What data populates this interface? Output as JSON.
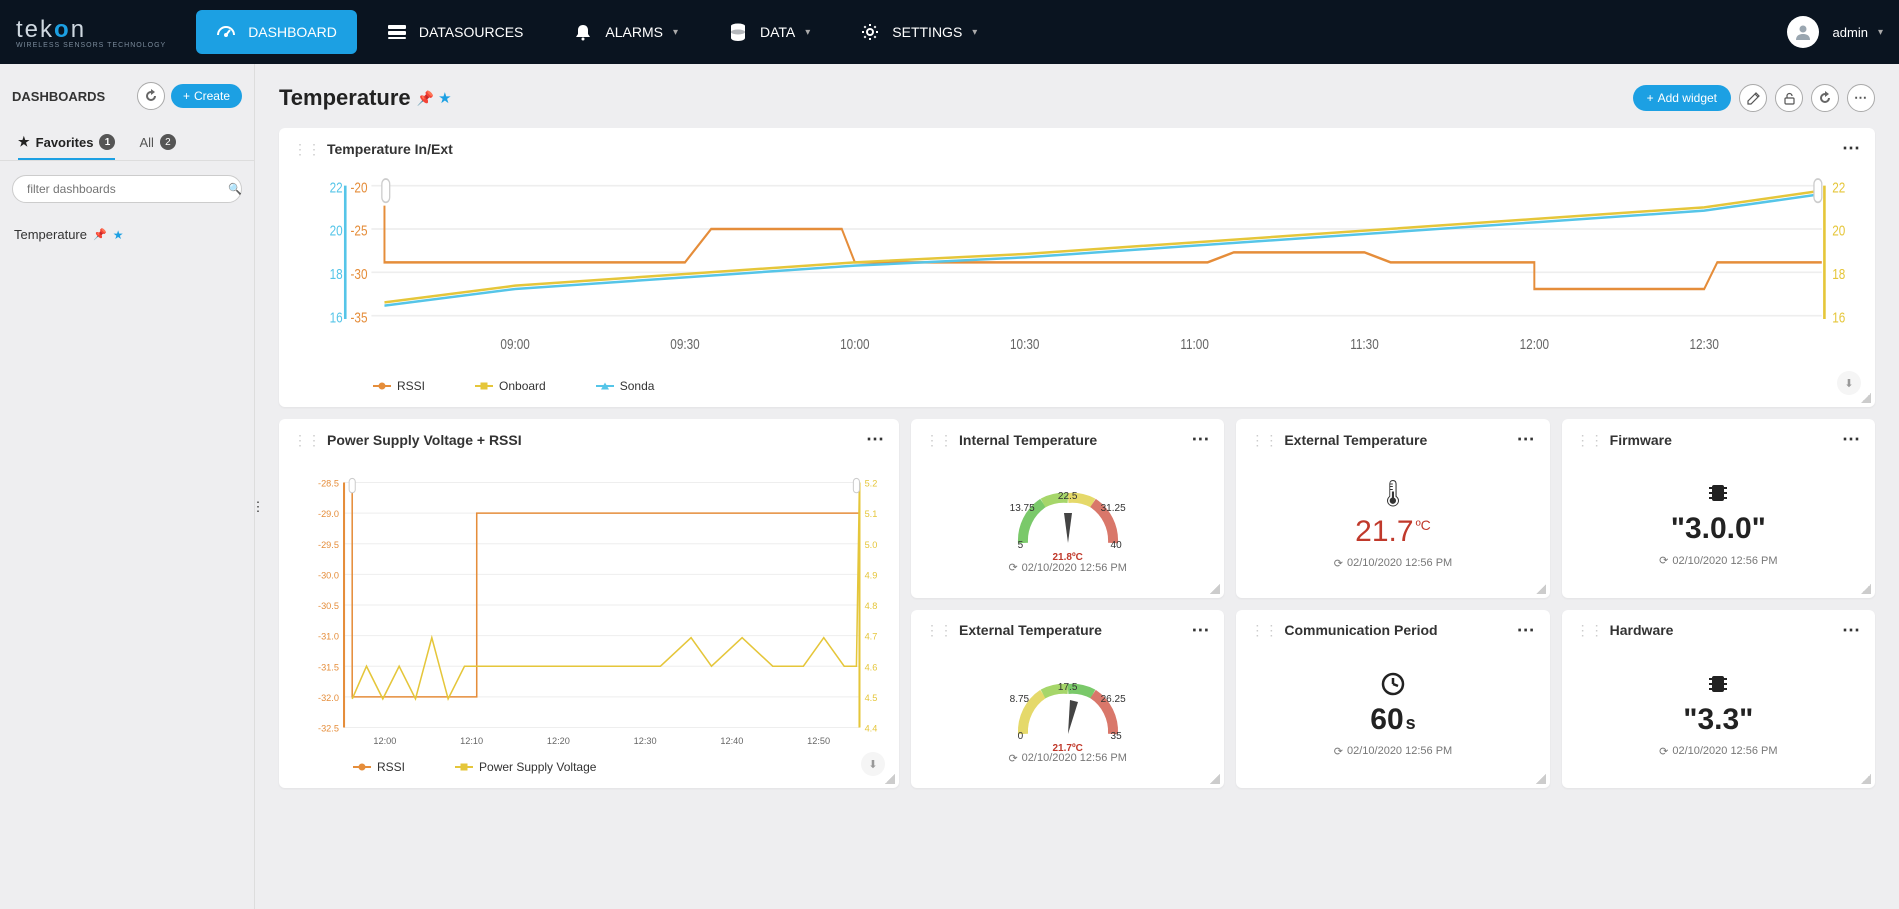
{
  "brand": {
    "name": "tekon",
    "tagline": "WIRELESS SENSORS TECHNOLOGY"
  },
  "nav": {
    "dashboard": "DASHBOARD",
    "datasources": "DATASOURCES",
    "alarms": "ALARMS",
    "data": "DATA",
    "settings": "SETTINGS"
  },
  "user": {
    "name": "admin"
  },
  "sidebar": {
    "title": "DASHBOARDS",
    "create_label": "Create",
    "tabs": {
      "favorites": "Favorites",
      "favorites_count": "1",
      "all": "All",
      "all_count": "2"
    },
    "filter_placeholder": "filter dashboards",
    "items": [
      {
        "label": "Temperature"
      }
    ]
  },
  "page": {
    "title": "Temperature",
    "add_widget_label": "Add widget"
  },
  "widgets": {
    "temp_chart": {
      "title": "Temperature In/Ext"
    },
    "psu_chart": {
      "title": "Power Supply Voltage + RSSI"
    },
    "internal_temp": {
      "title": "Internal Temperature",
      "value": "21.8",
      "unit": "ºC",
      "ts": "02/10/2020 12:56 PM"
    },
    "external_temp_big": {
      "title": "External Temperature",
      "value": "21.7",
      "unit": "ºC",
      "ts": "02/10/2020 12:56 PM"
    },
    "firmware": {
      "title": "Firmware",
      "value": "\"3.0.0\"",
      "ts": "02/10/2020 12:56 PM"
    },
    "external_temp_gauge": {
      "title": "External Temperature",
      "value": "21.7",
      "unit": "ºC",
      "ts": "02/10/2020 12:56 PM"
    },
    "comm_period": {
      "title": "Communication Period",
      "value": "60",
      "unit": "s",
      "ts": "02/10/2020 12:56 PM"
    },
    "hardware": {
      "title": "Hardware",
      "value": "\"3.3\"",
      "ts": "02/10/2020 12:56 PM"
    }
  },
  "chart_data": [
    {
      "id": "temp_chart",
      "title": "Temperature In/Ext",
      "type": "line",
      "x_ticks": [
        "09:00",
        "09:30",
        "10:00",
        "10:30",
        "11:00",
        "11:30",
        "12:00",
        "12:30"
      ],
      "axes": {
        "y_left": {
          "label": "",
          "ticks": [
            16,
            18,
            20,
            22
          ],
          "range": [
            16,
            22
          ],
          "color": "#55c5e8"
        },
        "y_left2": {
          "label": "",
          "ticks": [
            -35,
            -30,
            -25,
            -20
          ],
          "range": [
            -35,
            -20
          ],
          "color": "#e58d3a"
        },
        "y_right": {
          "label": "",
          "ticks": [
            16,
            18,
            20,
            22
          ],
          "range": [
            16,
            22
          ],
          "color": "#e5c63a"
        }
      },
      "series": [
        {
          "name": "RSSI",
          "color": "#e58d3a",
          "axis": "y_left2",
          "x": [
            "08:40",
            "09:00",
            "09:30",
            "09:40",
            "09:45",
            "10:10",
            "10:15",
            "11:10",
            "11:20",
            "11:40",
            "11:50",
            "12:00",
            "12:30",
            "12:55"
          ],
          "y": [
            -28,
            -29,
            -29,
            -29,
            -25,
            -25,
            -29,
            -29,
            -28,
            -28,
            -29,
            -29,
            -32,
            -29
          ]
        },
        {
          "name": "Onboard",
          "color": "#e5c63a",
          "axis": "y_right",
          "x": [
            "08:40",
            "09:00",
            "09:30",
            "10:00",
            "10:30",
            "11:00",
            "11:30",
            "12:00",
            "12:30",
            "12:55"
          ],
          "y": [
            17.0,
            17.8,
            18.3,
            18.8,
            19.2,
            19.8,
            20.3,
            20.8,
            21.3,
            21.8
          ]
        },
        {
          "name": "Sonda",
          "color": "#55c5e8",
          "axis": "y_left",
          "x": [
            "08:40",
            "09:00",
            "09:30",
            "10:00",
            "10:30",
            "11:00",
            "11:30",
            "12:00",
            "12:30",
            "12:55"
          ],
          "y": [
            16.8,
            17.6,
            18.1,
            18.6,
            19.0,
            19.6,
            20.1,
            20.6,
            21.1,
            21.7
          ]
        }
      ]
    },
    {
      "id": "psu_chart",
      "title": "Power Supply Voltage + RSSI",
      "type": "line",
      "x_ticks": [
        "12:00",
        "12:10",
        "12:20",
        "12:30",
        "12:40",
        "12:50"
      ],
      "axes": {
        "y_left": {
          "label": "",
          "ticks": [
            -32.5,
            -32.0,
            -31.5,
            -31.0,
            -30.5,
            -30.0,
            -29.5,
            -29.0,
            -28.5
          ],
          "range": [
            -32.5,
            -28.5
          ],
          "color": "#e58d3a"
        },
        "y_right": {
          "label": "",
          "ticks": [
            4.4,
            4.5,
            4.6,
            4.7,
            4.8,
            4.9,
            5.0,
            5.1,
            5.2
          ],
          "range": [
            4.4,
            5.2
          ],
          "color": "#e5c63a"
        }
      },
      "series": [
        {
          "name": "RSSI",
          "color": "#e58d3a",
          "axis": "y_left",
          "x": [
            "11:56",
            "11:58",
            "12:00",
            "12:11",
            "12:12",
            "12:57"
          ],
          "y": [
            -28.5,
            -32.0,
            -32.0,
            -32.0,
            -29.0,
            -29.0
          ]
        },
        {
          "name": "Power Supply Voltage",
          "color": "#e5c63a",
          "axis": "y_right",
          "x": [
            "11:56",
            "11:58",
            "12:00",
            "12:02",
            "12:04",
            "12:06",
            "12:08",
            "12:10",
            "12:20",
            "12:28",
            "12:32",
            "12:36",
            "12:38",
            "12:42",
            "12:46",
            "12:50",
            "12:52",
            "12:56",
            "12:57"
          ],
          "y": [
            4.5,
            4.6,
            4.5,
            4.6,
            4.5,
            4.7,
            4.5,
            4.6,
            4.6,
            4.6,
            4.6,
            4.7,
            4.6,
            4.7,
            4.6,
            4.6,
            4.7,
            4.6,
            5.2
          ]
        }
      ]
    },
    {
      "id": "internal_temp_gauge",
      "type": "gauge",
      "min": 5.0,
      "max": 40.0,
      "value": 21.8,
      "unit": "ºC",
      "ticks": [
        5.0,
        13.75,
        22.5,
        31.25,
        40.0
      ]
    },
    {
      "id": "external_temp_gauge",
      "type": "gauge",
      "min": 0.0,
      "max": 35.0,
      "value": 21.7,
      "unit": "ºC",
      "ticks": [
        0.0,
        8.75,
        17.5,
        26.25,
        35.0
      ]
    }
  ]
}
